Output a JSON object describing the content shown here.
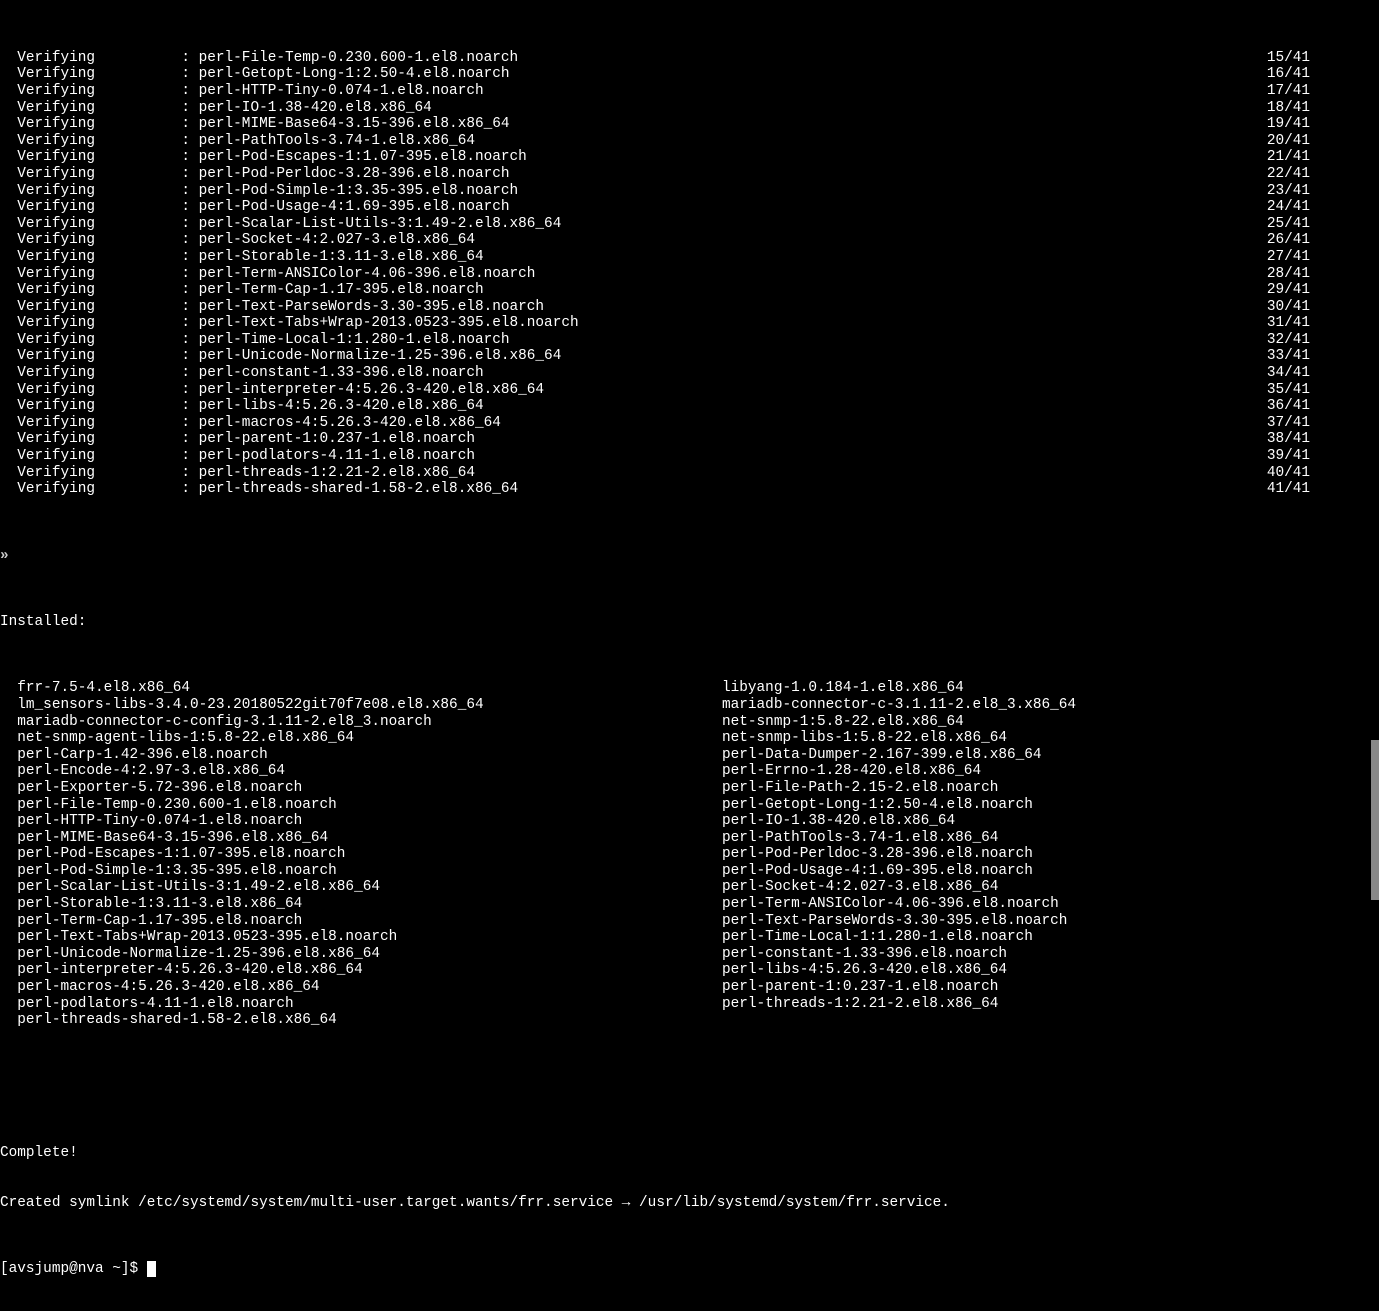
{
  "verifying": [
    {
      "pkg": "perl-File-Temp-0.230.600-1.el8.noarch",
      "n": 15
    },
    {
      "pkg": "perl-Getopt-Long-1:2.50-4.el8.noarch",
      "n": 16
    },
    {
      "pkg": "perl-HTTP-Tiny-0.074-1.el8.noarch",
      "n": 17
    },
    {
      "pkg": "perl-IO-1.38-420.el8.x86_64",
      "n": 18
    },
    {
      "pkg": "perl-MIME-Base64-3.15-396.el8.x86_64",
      "n": 19
    },
    {
      "pkg": "perl-PathTools-3.74-1.el8.x86_64",
      "n": 20
    },
    {
      "pkg": "perl-Pod-Escapes-1:1.07-395.el8.noarch",
      "n": 21
    },
    {
      "pkg": "perl-Pod-Perldoc-3.28-396.el8.noarch",
      "n": 22
    },
    {
      "pkg": "perl-Pod-Simple-1:3.35-395.el8.noarch",
      "n": 23
    },
    {
      "pkg": "perl-Pod-Usage-4:1.69-395.el8.noarch",
      "n": 24
    },
    {
      "pkg": "perl-Scalar-List-Utils-3:1.49-2.el8.x86_64",
      "n": 25
    },
    {
      "pkg": "perl-Socket-4:2.027-3.el8.x86_64",
      "n": 26
    },
    {
      "pkg": "perl-Storable-1:3.11-3.el8.x86_64",
      "n": 27
    },
    {
      "pkg": "perl-Term-ANSIColor-4.06-396.el8.noarch",
      "n": 28
    },
    {
      "pkg": "perl-Term-Cap-1.17-395.el8.noarch",
      "n": 29
    },
    {
      "pkg": "perl-Text-ParseWords-3.30-395.el8.noarch",
      "n": 30
    },
    {
      "pkg": "perl-Text-Tabs+Wrap-2013.0523-395.el8.noarch",
      "n": 31
    },
    {
      "pkg": "perl-Time-Local-1:1.280-1.el8.noarch",
      "n": 32
    },
    {
      "pkg": "perl-Unicode-Normalize-1.25-396.el8.x86_64",
      "n": 33
    },
    {
      "pkg": "perl-constant-1.33-396.el8.noarch",
      "n": 34
    },
    {
      "pkg": "perl-interpreter-4:5.26.3-420.el8.x86_64",
      "n": 35
    },
    {
      "pkg": "perl-libs-4:5.26.3-420.el8.x86_64",
      "n": 36
    },
    {
      "pkg": "perl-macros-4:5.26.3-420.el8.x86_64",
      "n": 37
    },
    {
      "pkg": "perl-parent-1:0.237-1.el8.noarch",
      "n": 38
    },
    {
      "pkg": "perl-podlators-4.11-1.el8.noarch",
      "n": 39
    },
    {
      "pkg": "perl-threads-1:2.21-2.el8.x86_64",
      "n": 40
    },
    {
      "pkg": "perl-threads-shared-1.58-2.el8.x86_64",
      "n": 41
    }
  ],
  "total": 41,
  "verify_label": "Verifying",
  "chevrons": "»",
  "installed_header": "Installed:",
  "installed_col_a": [
    "frr-7.5-4.el8.x86_64",
    "lm_sensors-libs-3.4.0-23.20180522git70f7e08.el8.x86_64",
    "mariadb-connector-c-config-3.1.11-2.el8_3.noarch",
    "net-snmp-agent-libs-1:5.8-22.el8.x86_64",
    "perl-Carp-1.42-396.el8.noarch",
    "perl-Encode-4:2.97-3.el8.x86_64",
    "perl-Exporter-5.72-396.el8.noarch",
    "perl-File-Temp-0.230.600-1.el8.noarch",
    "perl-HTTP-Tiny-0.074-1.el8.noarch",
    "perl-MIME-Base64-3.15-396.el8.x86_64",
    "perl-Pod-Escapes-1:1.07-395.el8.noarch",
    "perl-Pod-Simple-1:3.35-395.el8.noarch",
    "perl-Scalar-List-Utils-3:1.49-2.el8.x86_64",
    "perl-Storable-1:3.11-3.el8.x86_64",
    "perl-Term-Cap-1.17-395.el8.noarch",
    "perl-Text-Tabs+Wrap-2013.0523-395.el8.noarch",
    "perl-Unicode-Normalize-1.25-396.el8.x86_64",
    "perl-interpreter-4:5.26.3-420.el8.x86_64",
    "perl-macros-4:5.26.3-420.el8.x86_64",
    "perl-podlators-4.11-1.el8.noarch",
    "perl-threads-shared-1.58-2.el8.x86_64"
  ],
  "installed_col_b": [
    "libyang-1.0.184-1.el8.x86_64",
    "mariadb-connector-c-3.1.11-2.el8_3.x86_64",
    "net-snmp-1:5.8-22.el8.x86_64",
    "net-snmp-libs-1:5.8-22.el8.x86_64",
    "perl-Data-Dumper-2.167-399.el8.x86_64",
    "perl-Errno-1.28-420.el8.x86_64",
    "perl-File-Path-2.15-2.el8.noarch",
    "perl-Getopt-Long-1:2.50-4.el8.noarch",
    "perl-IO-1.38-420.el8.x86_64",
    "perl-PathTools-3.74-1.el8.x86_64",
    "perl-Pod-Perldoc-3.28-396.el8.noarch",
    "perl-Pod-Usage-4:1.69-395.el8.noarch",
    "perl-Socket-4:2.027-3.el8.x86_64",
    "perl-Term-ANSIColor-4.06-396.el8.noarch",
    "perl-Text-ParseWords-3.30-395.el8.noarch",
    "perl-Time-Local-1:1.280-1.el8.noarch",
    "perl-constant-1.33-396.el8.noarch",
    "perl-libs-4:5.26.3-420.el8.x86_64",
    "perl-parent-1:0.237-1.el8.noarch",
    "perl-threads-1:2.21-2.el8.x86_64"
  ],
  "complete": "Complete!",
  "symlink": "Created symlink /etc/systemd/system/multi-user.target.wants/frr.service → /usr/lib/systemd/system/frr.service.",
  "prompt": "[avsjump@nva ~]$ "
}
